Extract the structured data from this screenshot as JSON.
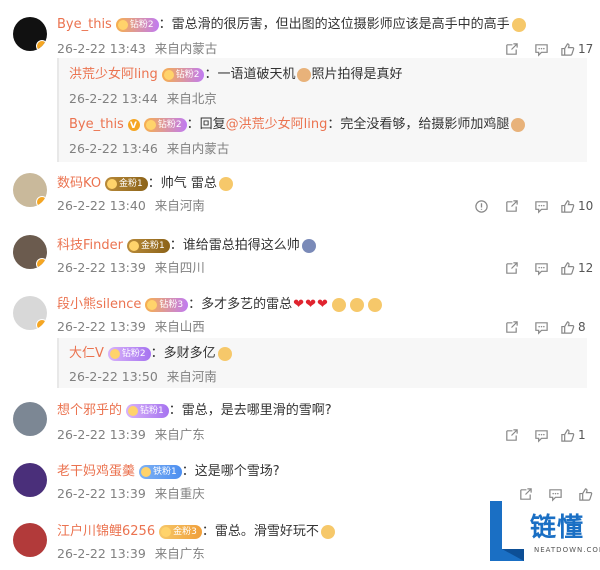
{
  "comments": [
    {
      "user": "Bye_this",
      "badge": "钻粉2",
      "text": "雷总滑的很厉害，但出图的这位摄影师应该是高手中的高手",
      "time": "26-2-22 13:43",
      "location": "来自内蒙古",
      "likes": "17",
      "replies": [
        {
          "user": "洪荒少女阿ling",
          "badge": "钻粉2",
          "text": "一语道破天机",
          "text2": "照片拍得是真好",
          "time": "26-2-22 13:44",
          "location": "来自北京"
        },
        {
          "user": "Bye_this",
          "badge": "钻粉2",
          "reply_prefix": "回复",
          "reply_to": "@洪荒少女阿ling",
          "text": "完全没看够，给摄影师加鸡腿",
          "time": "26-2-22 13:46",
          "location": "来自内蒙古"
        }
      ]
    },
    {
      "user": "数码KO",
      "badge": "金粉1",
      "text": "帅气 雷总",
      "time": "26-2-22 13:40",
      "location": "来自河南",
      "likes": "10"
    },
    {
      "user": "科技Finder",
      "badge": "金粉1",
      "text": "谁给雷总拍得这么帅",
      "time": "26-2-22 13:39",
      "location": "来自四川",
      "likes": "12"
    },
    {
      "user": "段小熊silence",
      "badge": "钻粉3",
      "text": "多才多艺的雷总",
      "time": "26-2-22 13:39",
      "location": "来自山西",
      "likes": "8",
      "replies": [
        {
          "user": "大仁V",
          "badge": "钻粉2",
          "text": "多财多亿",
          "time": "26-2-22 13:50",
          "location": "来自河南"
        }
      ]
    },
    {
      "user": "想个邪乎的",
      "badge": "钻粉1",
      "text": "雷总，是去哪里滑的雪啊?",
      "time": "26-2-22 13:39",
      "location": "来自广东",
      "likes": "1"
    },
    {
      "user": "老干妈鸡蛋羹",
      "badge": "铁粉1",
      "text": "这是哪个雪场?",
      "time": "26-2-22 13:39",
      "location": "来自重庆",
      "likes": ""
    },
    {
      "user": "江户川锦鲤6256",
      "badge": "金粉3",
      "text": "雷总。滑雪好玩不",
      "time": "26-2-22 13:39",
      "location": "来自广东",
      "likes": ""
    }
  ],
  "colon": "：",
  "logo": {
    "text": "链懂",
    "site": "NEATDOWN.COM"
  },
  "colors": {
    "username": "#eb7350",
    "meta": "#808080",
    "logo_blue": "#1a6fc4"
  }
}
